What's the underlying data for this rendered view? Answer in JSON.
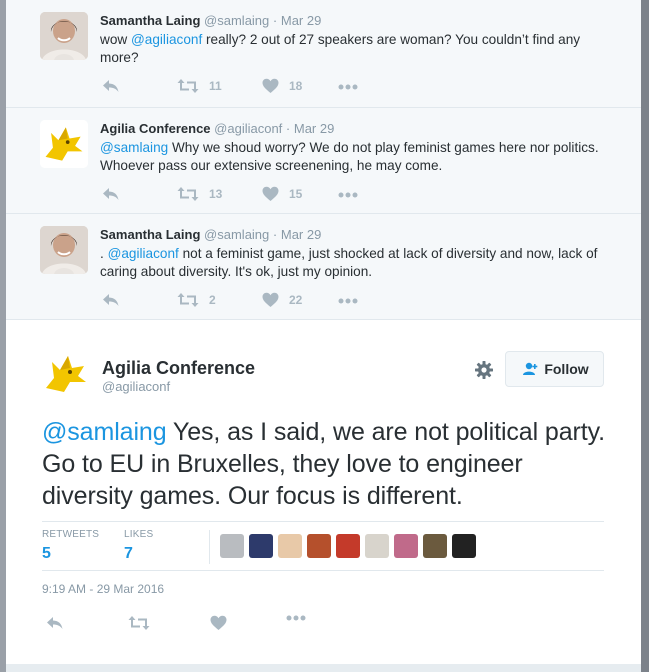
{
  "colors": {
    "accent": "#1b95e0",
    "text": "#292f33",
    "muted": "#8899a6",
    "icon": "#aab8c2",
    "logo_yellow": "#f2c500"
  },
  "ancestor_tweets": [
    {
      "name": "Samantha Laing",
      "handle": "@samlaing",
      "date": "Mar 29",
      "mention": "@agiliaconf",
      "text_before": "wow ",
      "text_after": " really? 2 out of 27 speakers are woman? You couldn’t find any more?",
      "retweets": "11",
      "likes": "18",
      "avatar_icon": "person-avatar"
    },
    {
      "name": "Agilia Conference",
      "handle": "@agiliaconf",
      "date": "Mar 29",
      "mention": "@samlaing",
      "text_before": "",
      "text_after": " Why we shoud worry? We do not play feminist games here nor politics. Whoever pass our extensive screenening, he may come.",
      "retweets": "13",
      "likes": "15",
      "avatar_icon": "agilia-fox-logo"
    },
    {
      "name": "Samantha Laing",
      "handle": "@samlaing",
      "date": "Mar 29",
      "mention": "@agiliaconf",
      "text_before": ". ",
      "text_after": " not a feminist game, just shocked at lack of diversity and now, lack of caring about diversity. It's ok, just my opinion.",
      "retweets": "2",
      "likes": "22",
      "avatar_icon": "person-avatar"
    }
  ],
  "main_tweet": {
    "name": "Agilia Conference",
    "handle": "@agiliaconf",
    "follow_label": "Follow",
    "mention": "@samlaing",
    "text": " Yes, as I said, we are not political party. Go to EU in Bruxelles, they love to engineer diversity games. Our focus is different.",
    "retweets_label": "RETWEETS",
    "retweets_value": "5",
    "likes_label": "LIKES",
    "likes_value": "7",
    "timestamp": "9:19 AM - 29 Mar 2016",
    "liker_colors": [
      "#b9bcc0",
      "#2d3a6b",
      "#e8c9a8",
      "#b5502c",
      "#c43a2a",
      "#d8d4cc",
      "#c06a8a",
      "#6b5a3e",
      "#222222"
    ]
  },
  "separator": "·",
  "icons": [
    "reply-icon",
    "retweet-icon",
    "heart-icon",
    "more-icon",
    "gear-icon",
    "follow-person-icon"
  ]
}
